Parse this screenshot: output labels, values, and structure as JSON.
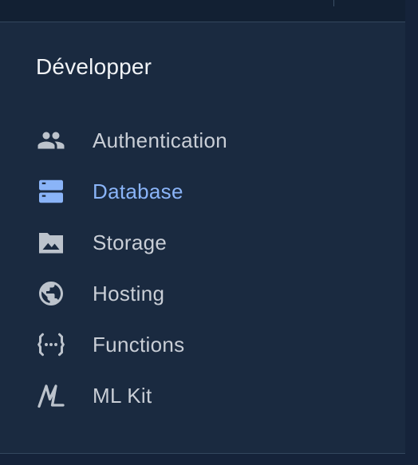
{
  "section_title": "Développer",
  "colors": {
    "background": "#1a2a40",
    "text": "#c9ced6",
    "icon": "#bcc3cc",
    "active": "#8ab4f8"
  },
  "nav": {
    "items": [
      {
        "label": "Authentication",
        "icon": "people-icon",
        "active": false
      },
      {
        "label": "Database",
        "icon": "database-icon",
        "active": true
      },
      {
        "label": "Storage",
        "icon": "storage-photo-icon",
        "active": false
      },
      {
        "label": "Hosting",
        "icon": "globe-icon",
        "active": false
      },
      {
        "label": "Functions",
        "icon": "functions-icon",
        "active": false
      },
      {
        "label": "ML Kit",
        "icon": "ml-kit-icon",
        "active": false
      }
    ]
  }
}
